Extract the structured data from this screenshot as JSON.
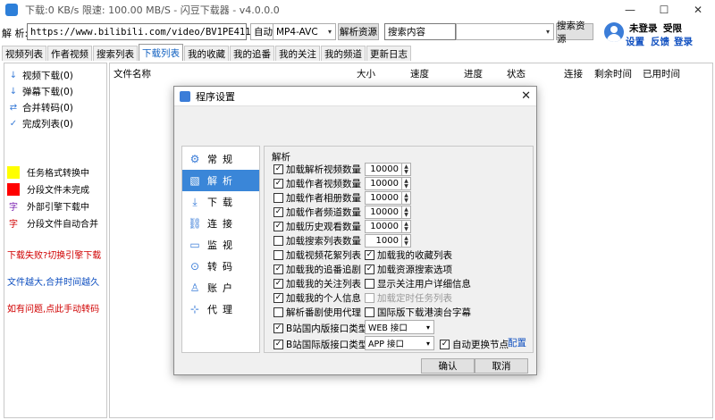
{
  "window": {
    "title": "下载:0 KB/s  限速: 100.00 MB/S  - 闪豆下载器 - v4.0.0.0"
  },
  "toolbar": {
    "parse_label": "解 析:",
    "url_value": "https://www.bilibili.com/video/BV1PE411i7CV",
    "quality_value": "自动",
    "format_value": "MP4-AVC",
    "parse_button": "解析资源",
    "search_value": "搜索内容",
    "search_button": "搜索资源"
  },
  "user": {
    "status": "未登录",
    "vip": "受限",
    "settings": "设置",
    "feedback": "反馈",
    "login": "登录"
  },
  "tabs": [
    "视频列表",
    "作者视频",
    "搜索列表",
    "下载列表",
    "我的收藏",
    "我的追番",
    "我的关注",
    "我的频道",
    "更新日志"
  ],
  "active_tab": "下载列表",
  "sidebar": {
    "items": [
      {
        "label": "视频下载(0)",
        "icon": "download-arrow-icon"
      },
      {
        "label": "弹幕下载(0)",
        "icon": "download-arrow-icon"
      },
      {
        "label": "合并转码(0)",
        "icon": "merge-icon"
      },
      {
        "label": "完成列表(0)",
        "icon": "check-icon"
      }
    ],
    "legend": [
      {
        "label": "任务格式转换中",
        "color": "#ffff00"
      },
      {
        "label": "分段文件未完成",
        "color": "#ff0000"
      },
      {
        "label": "外部引擎下载中",
        "glyph": "字"
      },
      {
        "label": "分段文件自动合并",
        "glyph": "字"
      }
    ],
    "notes": [
      {
        "text": "下载失败?切换引擎下载",
        "color": "#d00000"
      },
      {
        "text": "文件越大,合并时间越久",
        "color": "#1050c0"
      },
      {
        "text": "如有问题,点此手动转码",
        "color": "#d00000"
      }
    ]
  },
  "table": {
    "columns": [
      "文件名称",
      "大小",
      "速度",
      "进度",
      "状态",
      "连接",
      "剩余时间",
      "已用时间"
    ]
  },
  "dialog": {
    "title": "程序设置",
    "nav": [
      {
        "label": "常规",
        "icon": "general-settings-icon"
      },
      {
        "label": "解析",
        "icon": "parse-icon"
      },
      {
        "label": "下载",
        "icon": "download-icon"
      },
      {
        "label": "连接",
        "icon": "link-icon"
      },
      {
        "label": "监视",
        "icon": "monitor-icon"
      },
      {
        "label": "转码",
        "icon": "transcode-icon"
      },
      {
        "label": "账户",
        "icon": "account-icon"
      },
      {
        "label": "代理",
        "icon": "proxy-icon"
      }
    ],
    "selected_nav": "解析",
    "section_title": "解析",
    "spin_options": [
      {
        "label": "加载解析视频数量",
        "checked": true,
        "value": "10000"
      },
      {
        "label": "加载作者视频数量",
        "checked": true,
        "value": "10000"
      },
      {
        "label": "加载作者相册数量",
        "checked": false,
        "value": "10000"
      },
      {
        "label": "加载作者频道数量",
        "checked": true,
        "value": "10000"
      },
      {
        "label": "加载历史观看数量",
        "checked": true,
        "value": "10000"
      },
      {
        "label": "加载搜索列表数量",
        "checked": false,
        "value": "1000"
      }
    ],
    "left_checks": [
      {
        "label": "加载视频花絮列表",
        "checked": false
      },
      {
        "label": "加载我的追番追剧",
        "checked": true
      },
      {
        "label": "加载我的关注列表",
        "checked": true
      },
      {
        "label": "加载我的个人信息",
        "checked": true
      },
      {
        "label": "解析番剧使用代理",
        "checked": false
      }
    ],
    "right_checks": [
      {
        "label": "加载我的收藏列表",
        "checked": true,
        "disabled": false
      },
      {
        "label": "加载资源搜索选项",
        "checked": true,
        "disabled": false
      },
      {
        "label": "显示关注用户详细信息",
        "checked": false,
        "disabled": false
      },
      {
        "label": "加载定时任务列表",
        "checked": false,
        "disabled": true
      },
      {
        "label": "国际版下载港澳台字幕",
        "checked": false,
        "disabled": false
      }
    ],
    "domestic_api": {
      "label": "B站国内版接口类型",
      "checked": true,
      "value": "WEB 接口"
    },
    "intl_api": {
      "label": "B站国际版接口类型",
      "checked": true,
      "value": "APP 接口"
    },
    "auto_node": {
      "label": "自动更换节点",
      "checked": true
    },
    "config_link": "配置",
    "ok": "确认",
    "cancel": "取消"
  }
}
